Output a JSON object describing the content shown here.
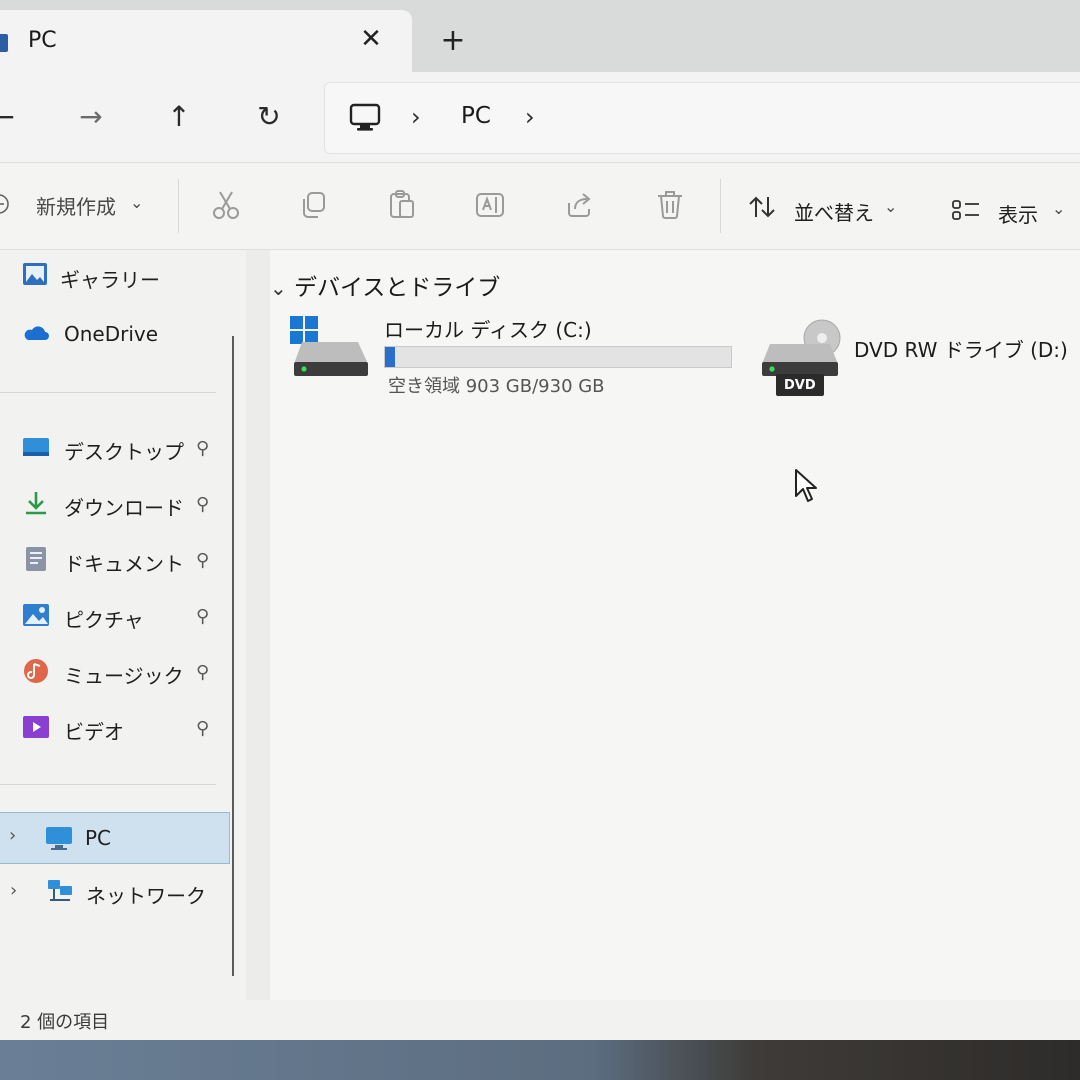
{
  "tab": {
    "title": "PC",
    "close_glyph": "✕",
    "new_tab_glyph": "+"
  },
  "nav": {
    "back_glyph": "←",
    "forward_glyph": "→",
    "up_glyph": "↑",
    "refresh_glyph": "↻",
    "breadcrumb": [
      {
        "label": "PC"
      }
    ],
    "sep_glyph": "›"
  },
  "command_bar": {
    "new_label": "新規作成",
    "sort_label": "並べ替え",
    "view_label": "表示",
    "dropdown_glyph": "⌄"
  },
  "sidebar": {
    "top_items": [
      {
        "label": "ギャラリー",
        "icon": "gallery-icon"
      },
      {
        "label": "OneDrive",
        "icon": "onedrive-icon"
      }
    ],
    "pinned_items": [
      {
        "label": "デスクトップ",
        "icon": "desktop-icon"
      },
      {
        "label": "ダウンロード",
        "icon": "download-icon"
      },
      {
        "label": "ドキュメント",
        "icon": "documents-icon"
      },
      {
        "label": "ピクチャ",
        "icon": "pictures-icon"
      },
      {
        "label": "ミュージック",
        "icon": "music-icon"
      },
      {
        "label": "ビデオ",
        "icon": "video-icon"
      }
    ],
    "tree_items": [
      {
        "label": "PC",
        "icon": "pc-icon",
        "selected": true
      },
      {
        "label": "ネットワーク",
        "icon": "network-icon",
        "selected": false
      }
    ],
    "pin_glyph": "📌",
    "chev_glyph": "›"
  },
  "main": {
    "group_title": "デバイスとドライブ",
    "group_chev": "⌄",
    "drives": [
      {
        "name": "ローカル ディスク (C:)",
        "free_text": "空き領域 903 GB/930 GB",
        "used_fraction": 0.029,
        "icon": "hard-drive-icon"
      },
      {
        "name": "DVD RW ドライブ (D:)",
        "icon": "dvd-drive-icon",
        "badge": "DVD"
      }
    ]
  },
  "status": {
    "text": "2 個の項目"
  },
  "colors": {
    "accent": "#2a6fc9",
    "selection": "#cfe0ef"
  }
}
